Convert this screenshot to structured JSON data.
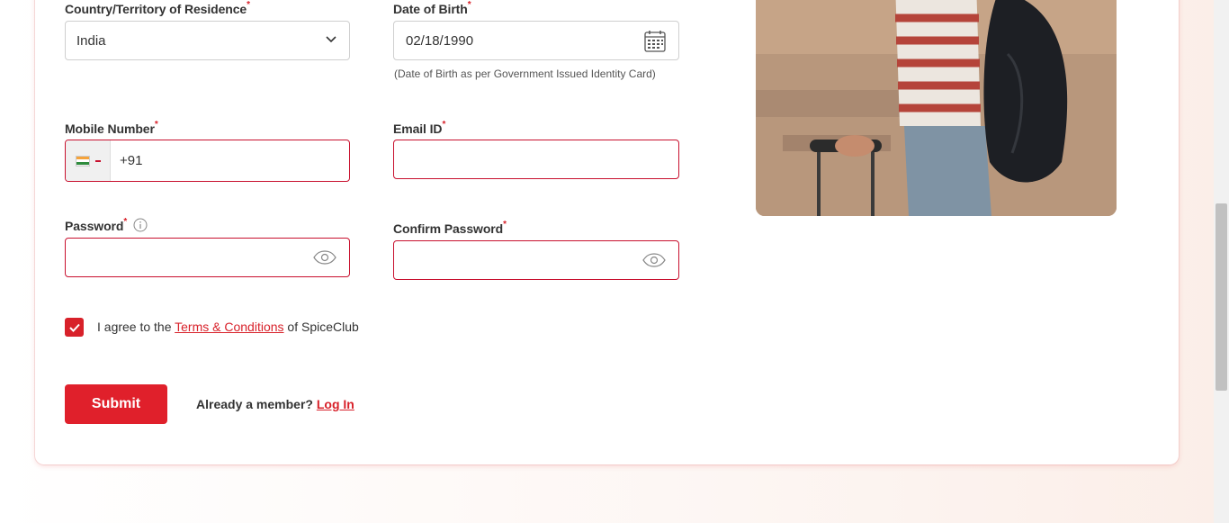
{
  "form": {
    "country": {
      "label": "Country/Territory of Residence",
      "required_mark": "*",
      "value": "India"
    },
    "dob": {
      "label": "Date of Birth",
      "required_mark": "*",
      "value": "02/18/1990",
      "hint": "(Date of Birth as per Government Issued Identity Card)"
    },
    "mobile": {
      "label": "Mobile Number",
      "required_mark": "*",
      "code": "+91"
    },
    "email": {
      "label": "Email ID",
      "required_mark": "*",
      "value": ""
    },
    "password": {
      "label": "Password",
      "required_mark": "*",
      "value": ""
    },
    "confirm_password": {
      "label": "Confirm Password",
      "required_mark": "*",
      "value": ""
    },
    "agree": {
      "prefix": "I agree to the ",
      "link": "Terms & Conditions",
      "suffix": " of SpiceClub",
      "checked": true
    },
    "submit_label": "Submit",
    "member_text": "Already a member? ",
    "login_link": "Log In"
  },
  "colors": {
    "accent": "#d8212a",
    "error_border": "#c8102e",
    "submit": "#e0202b"
  },
  "icons": [
    "chevron-down-icon",
    "calendar-icon",
    "india-flag-icon",
    "info-icon",
    "eye-icon",
    "checkmark-icon"
  ]
}
